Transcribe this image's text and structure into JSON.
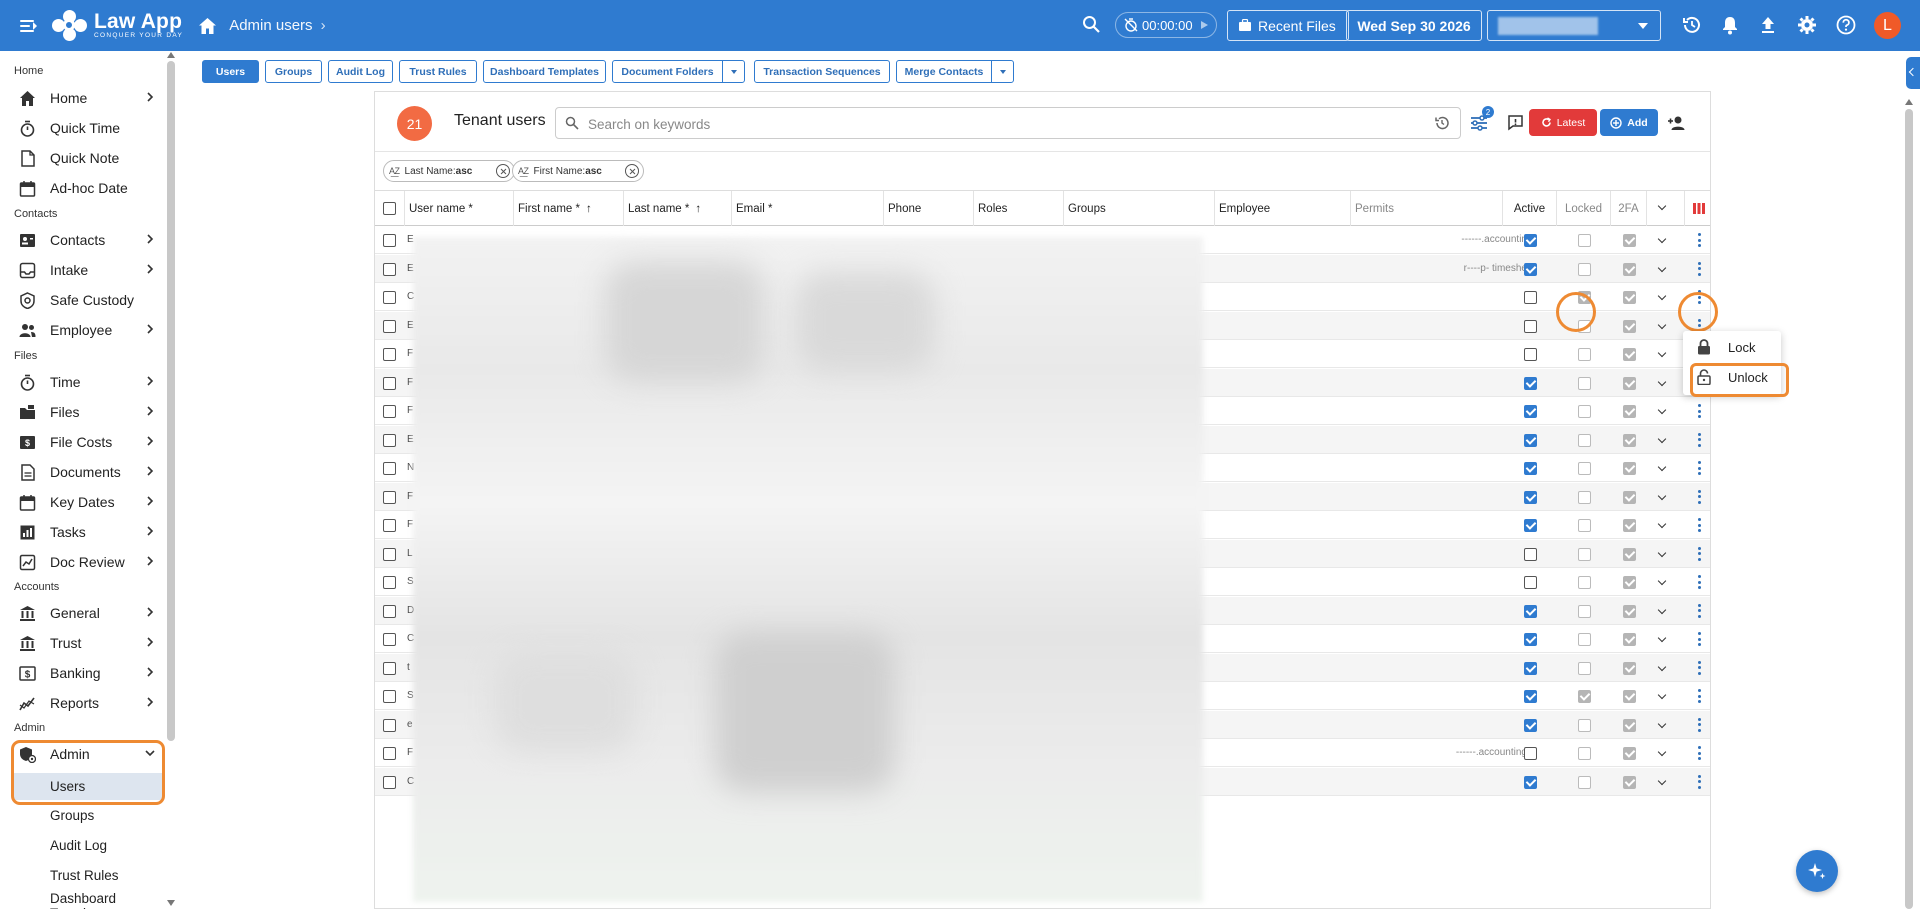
{
  "app": {
    "logo_title": "Law App",
    "logo_tagline": "CONQUER YOUR DAY",
    "breadcrumb": "Admin users",
    "timer": "00:00:00",
    "recent_files_label": "Recent Files",
    "date_label": "Wed Sep 30 2026",
    "avatar_initial": "L",
    "brand_color": "#2f7bd0",
    "highlight_color": "#ee8a32"
  },
  "sidebar": {
    "sections": {
      "home": "Home",
      "contacts": "Contacts",
      "files": "Files",
      "accounts": "Accounts",
      "admin": "Admin"
    },
    "items": [
      {
        "label": "Home",
        "icon": "home-icon",
        "chevron": true
      },
      {
        "label": "Quick Time",
        "icon": "stopwatch-icon",
        "chevron": false
      },
      {
        "label": "Quick Note",
        "icon": "note-icon",
        "chevron": false
      },
      {
        "label": "Ad-hoc Date",
        "icon": "calendar-icon",
        "chevron": false
      },
      {
        "label": "Contacts",
        "icon": "contacts-icon",
        "chevron": true
      },
      {
        "label": "Intake",
        "icon": "intake-icon",
        "chevron": true
      },
      {
        "label": "Safe Custody",
        "icon": "safe-icon",
        "chevron": false
      },
      {
        "label": "Employee",
        "icon": "employee-icon",
        "chevron": true
      },
      {
        "label": "Time",
        "icon": "stopwatch-icon",
        "chevron": true
      },
      {
        "label": "Files",
        "icon": "files-icon",
        "chevron": true
      },
      {
        "label": "File Costs",
        "icon": "file-costs-icon",
        "chevron": true
      },
      {
        "label": "Documents",
        "icon": "document-icon",
        "chevron": true
      },
      {
        "label": "Key Dates",
        "icon": "calendar-icon",
        "chevron": true
      },
      {
        "label": "Tasks",
        "icon": "tasks-icon",
        "chevron": true
      },
      {
        "label": "Doc Review",
        "icon": "doc-review-icon",
        "chevron": true
      },
      {
        "label": "General",
        "icon": "bank-icon",
        "chevron": true
      },
      {
        "label": "Trust",
        "icon": "bank-icon",
        "chevron": true
      },
      {
        "label": "Banking",
        "icon": "banking-icon",
        "chevron": true
      },
      {
        "label": "Reports",
        "icon": "reports-icon",
        "chevron": true
      },
      {
        "label": "Admin",
        "icon": "admin-icon",
        "chevron": true
      }
    ],
    "admin_subitems": [
      "Users",
      "Groups",
      "Audit Log",
      "Trust Rules",
      "Dashboard Templa"
    ]
  },
  "tabs": [
    {
      "label": "Users",
      "active": true
    },
    {
      "label": "Groups",
      "active": false
    },
    {
      "label": "Audit Log",
      "active": false
    },
    {
      "label": "Trust Rules",
      "active": false
    },
    {
      "label": "Dashboard Templates",
      "active": false
    },
    {
      "label": "Document Folders",
      "active": false,
      "split": true
    },
    {
      "label": "Transaction Sequences",
      "active": false
    },
    {
      "label": "Merge Contacts",
      "active": false,
      "split": true
    }
  ],
  "card": {
    "count": "21",
    "title": "Tenant users",
    "search_placeholder": "Search on keywords",
    "filter_count": "2",
    "latest_label": "Latest",
    "add_label": "Add"
  },
  "sort_chips": [
    {
      "prefix": "Last Name:",
      "value": "asc"
    },
    {
      "prefix": "First Name:",
      "value": "asc"
    }
  ],
  "columns": [
    "User name *",
    "First name *",
    "Last name *",
    "Email *",
    "Phone",
    "Roles",
    "Groups",
    "Employee",
    "Permits",
    "Active",
    "Locked",
    "2FA"
  ],
  "rows": [
    {
      "initial": "E",
      "permits": "------.accountin",
      "active": true,
      "locked": false,
      "twofa": true
    },
    {
      "initial": "E",
      "permits": "r----p- timeshe",
      "active": true,
      "locked": false,
      "twofa": true
    },
    {
      "initial": "C",
      "permits": "",
      "active": false,
      "locked": true,
      "twofa": true
    },
    {
      "initial": "E",
      "permits": "",
      "active": false,
      "locked": false,
      "twofa": true
    },
    {
      "initial": "F",
      "permits": "",
      "active": false,
      "locked": false,
      "twofa": true
    },
    {
      "initial": "F",
      "permits": "",
      "active": true,
      "locked": false,
      "twofa": true
    },
    {
      "initial": "F",
      "permits": "",
      "active": true,
      "locked": false,
      "twofa": true
    },
    {
      "initial": "E",
      "permits": "",
      "active": true,
      "locked": false,
      "twofa": true
    },
    {
      "initial": "N",
      "permits": "",
      "active": true,
      "locked": false,
      "twofa": true
    },
    {
      "initial": "F",
      "permits": "",
      "active": true,
      "locked": false,
      "twofa": true
    },
    {
      "initial": "F",
      "permits": "",
      "active": true,
      "locked": false,
      "twofa": true
    },
    {
      "initial": "L",
      "permits": "",
      "active": false,
      "locked": false,
      "twofa": true
    },
    {
      "initial": "S",
      "permits": "",
      "active": false,
      "locked": false,
      "twofa": true
    },
    {
      "initial": "D",
      "permits": "",
      "active": true,
      "locked": false,
      "twofa": true
    },
    {
      "initial": "C",
      "permits": "",
      "active": true,
      "locked": false,
      "twofa": true
    },
    {
      "initial": "t",
      "permits": "",
      "active": true,
      "locked": false,
      "twofa": true
    },
    {
      "initial": "S",
      "permits": "",
      "active": true,
      "locked": true,
      "twofa": true
    },
    {
      "initial": "e",
      "permits": "",
      "active": true,
      "locked": false,
      "twofa": true
    },
    {
      "initial": "F",
      "permits": "------.accounting",
      "active": false,
      "locked": false,
      "twofa": true
    },
    {
      "initial": "C",
      "permits": "",
      "active": true,
      "locked": false,
      "twofa": true
    }
  ],
  "context_menu": {
    "lock_label": "Lock",
    "unlock_label": "Unlock"
  }
}
